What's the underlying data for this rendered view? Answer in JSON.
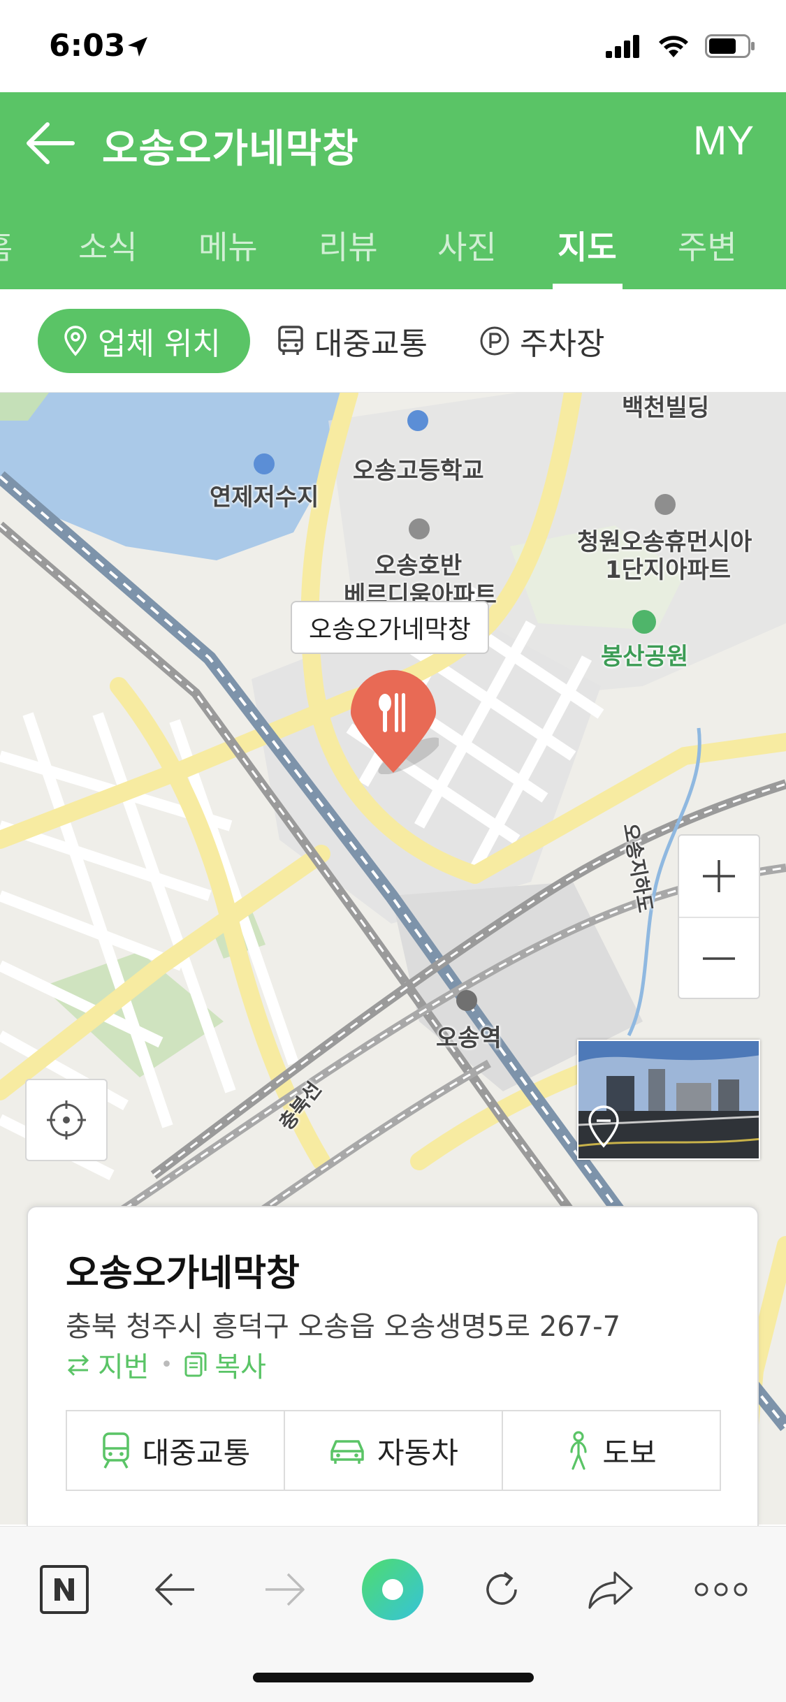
{
  "status_bar": {
    "time": "6:03"
  },
  "header": {
    "title": "오송오가네막창",
    "my_label": "MY"
  },
  "tabs": [
    {
      "label": "홈"
    },
    {
      "label": "소식"
    },
    {
      "label": "메뉴"
    },
    {
      "label": "리뷰"
    },
    {
      "label": "사진"
    },
    {
      "label": "지도",
      "active": true
    },
    {
      "label": "주변"
    }
  ],
  "chips": {
    "location": "업체 위치",
    "transit": "대중교통",
    "parking": "주차장"
  },
  "map": {
    "labels": {
      "baekcheon": "백천빌딩",
      "highschool": "오송고등학교",
      "reservoir": "연제저수지",
      "apt1": "오송호반",
      "apt2": "베르디움아파트",
      "apt3": "청원오송휴먼시아",
      "apt4": "1단지아파트",
      "park": "봉산공원",
      "station": "오송역",
      "underpass": "오송지하도",
      "railline": "충북선"
    },
    "marker_label": "오송오가네막창"
  },
  "card": {
    "title": "오송오가네막창",
    "address": "충북 청주시 흥덕구 오송읍 오송생명5로 267-7",
    "jibun_label": "지번",
    "copy_label": "복사",
    "routes": {
      "transit": "대중교통",
      "car": "자동차",
      "walk": "도보"
    }
  },
  "colors": {
    "brand_green": "#5ac466",
    "marker_red": "#e86a55"
  }
}
